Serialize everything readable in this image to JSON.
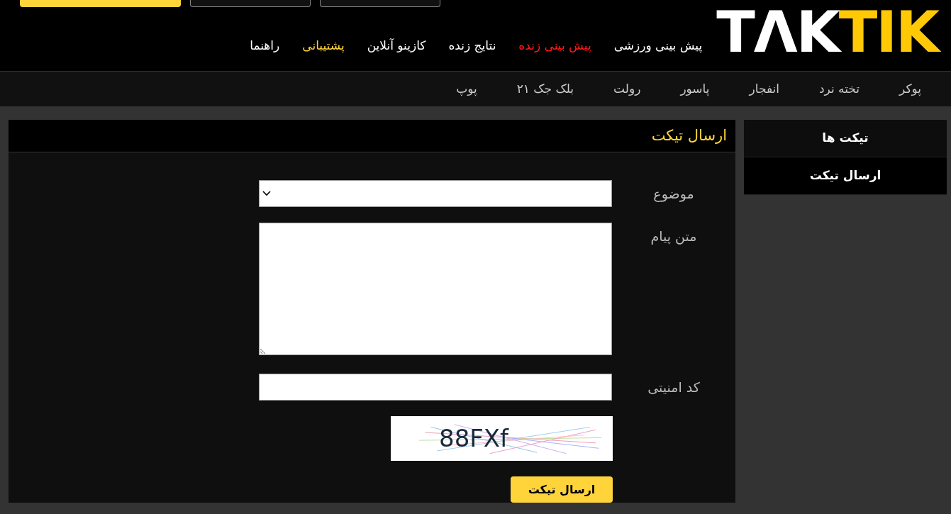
{
  "header": {
    "logo": {
      "part_1": "TΛK",
      "part_2": "TIK"
    },
    "top_buttons": [
      {
        "kind": "outline"
      },
      {
        "kind": "outline"
      },
      {
        "kind": "filled"
      }
    ],
    "nav": [
      {
        "label": "پیش بینی ورزشی",
        "color": "#ffffff"
      },
      {
        "label": "پیش بینی زنده",
        "color": "#ff1a1a"
      },
      {
        "label": "نتایج زنده",
        "color": "#ffffff"
      },
      {
        "label": "کازینو آنلاین",
        "color": "#ffffff"
      },
      {
        "label": "پشتیبانی",
        "color": "#ffd43b"
      },
      {
        "label": "راهنما",
        "color": "#ffffff"
      }
    ]
  },
  "subnav": [
    "پوکر",
    "تخته نرد",
    "انفجار",
    "پاسور",
    "رولت",
    "بلک جک ۲۱",
    "پوپ"
  ],
  "sidebar": [
    {
      "label": "تیکت ها",
      "selected": false
    },
    {
      "label": "ارسال تیکت",
      "selected": true
    }
  ],
  "panel": {
    "title": "ارسال تیکت",
    "form": {
      "subject_label": "موضوع",
      "message_label": "متن پیام",
      "code_label": "کد امنیتی",
      "captcha_text": "88FXf",
      "submit": "ارسال تیکت"
    }
  }
}
